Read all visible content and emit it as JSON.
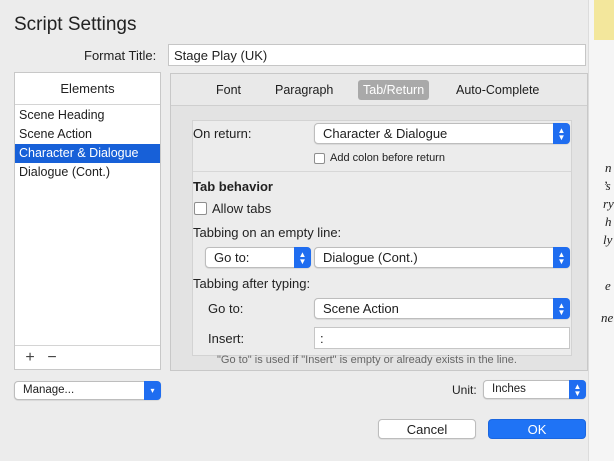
{
  "window": {
    "title": "Script Settings"
  },
  "format": {
    "label": "Format Title:",
    "value": "Stage Play (UK)"
  },
  "elements": {
    "header": "Elements",
    "items": [
      {
        "label": "Scene Heading",
        "selected": false
      },
      {
        "label": "Scene Action",
        "selected": false
      },
      {
        "label": "Character & Dialogue",
        "selected": true
      },
      {
        "label": "Dialogue (Cont.)",
        "selected": false
      }
    ],
    "add_label": "+",
    "remove_label": "−"
  },
  "manage": {
    "value": "Manage..."
  },
  "tabs": [
    {
      "label": "Font",
      "active": false
    },
    {
      "label": "Paragraph",
      "active": false
    },
    {
      "label": "Tab/Return",
      "active": true
    },
    {
      "label": "Auto-Complete",
      "active": false
    }
  ],
  "on_return": {
    "label": "On return:",
    "value": "Character & Dialogue",
    "add_colon_label": "Add colon before return",
    "add_colon_checked": false
  },
  "tab_behavior": {
    "heading": "Tab behavior",
    "allow_tabs_label": "Allow tabs",
    "allow_tabs_checked": false
  },
  "empty_line": {
    "label": "Tabbing on an empty line:",
    "action": "Go to:",
    "target": "Dialogue (Cont.)"
  },
  "after_typing": {
    "label": "Tabbing after typing:",
    "goto_label": "Go to:",
    "goto_value": "Scene Action",
    "insert_label": "Insert:",
    "insert_value": ":"
  },
  "hint": "\"Go to\" is used if \"Insert\" is empty or already exists in the line.",
  "unit": {
    "label": "Unit:",
    "value": "Inches"
  },
  "buttons": {
    "cancel": "Cancel",
    "ok": "OK"
  },
  "background_fragments": [
    "n",
    "’s",
    "ry",
    "h",
    "ly",
    "e",
    "ne"
  ],
  "colors": {
    "accent": "#1f73f5",
    "selection": "#1760d8",
    "window_bg": "#ececec"
  }
}
